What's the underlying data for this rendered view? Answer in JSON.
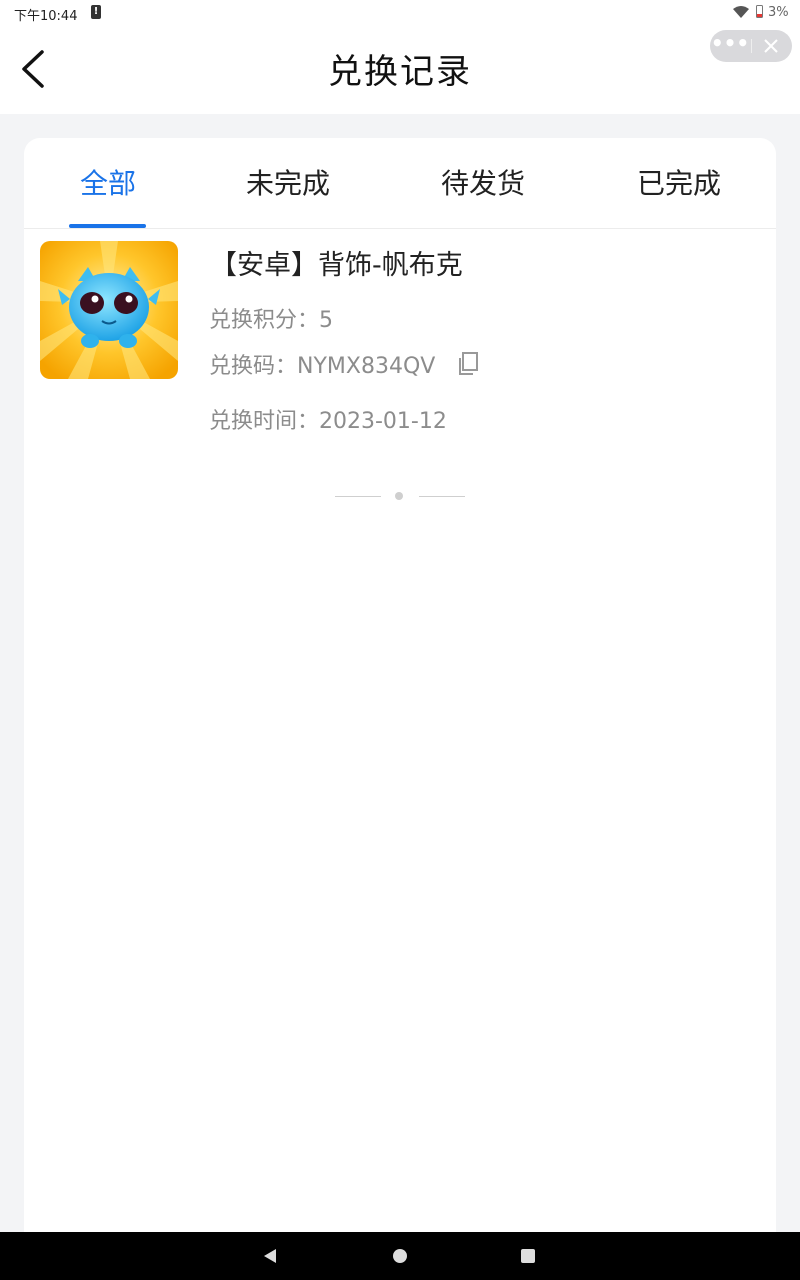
{
  "status_bar": {
    "time": "下午10:44",
    "battery_percent": "3%",
    "alert_glyph": "!"
  },
  "header": {
    "title": "兑换记录",
    "more_glyph": "•••",
    "icons": [
      "back-chevron-icon",
      "more-icon",
      "close-icon"
    ]
  },
  "tabs": [
    {
      "label": "全部",
      "active": true
    },
    {
      "label": "未完成",
      "active": false
    },
    {
      "label": "待发货",
      "active": false
    },
    {
      "label": "已完成",
      "active": false
    }
  ],
  "records": [
    {
      "title": "【安卓】背饰-帆布克",
      "points": "兑换积分：5",
      "code": "兑换码：NYMX834QV",
      "time": "兑换时间：2023-01-12",
      "thumbnail_icon": "blue-monster-icon"
    }
  ],
  "colors": {
    "accent": "#1a73e8",
    "text_primary": "#222222",
    "text_secondary": "#8c8c8c",
    "background": "#f3f4f6",
    "card": "#ffffff"
  }
}
